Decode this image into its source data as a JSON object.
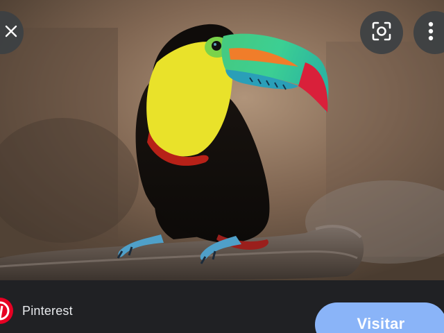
{
  "image": {
    "subject": "keel-billed toucan on branch"
  },
  "toolbar": {
    "close_icon": "close-icon",
    "lens_icon": "google-lens-icon",
    "more_icon": "more-vert-icon"
  },
  "source": {
    "name": "Pinterest",
    "logo_icon": "pinterest-logo-icon",
    "logo_color": "#e60023"
  },
  "visit_button": {
    "label": "Visitar",
    "color": "#8ab4f8"
  }
}
